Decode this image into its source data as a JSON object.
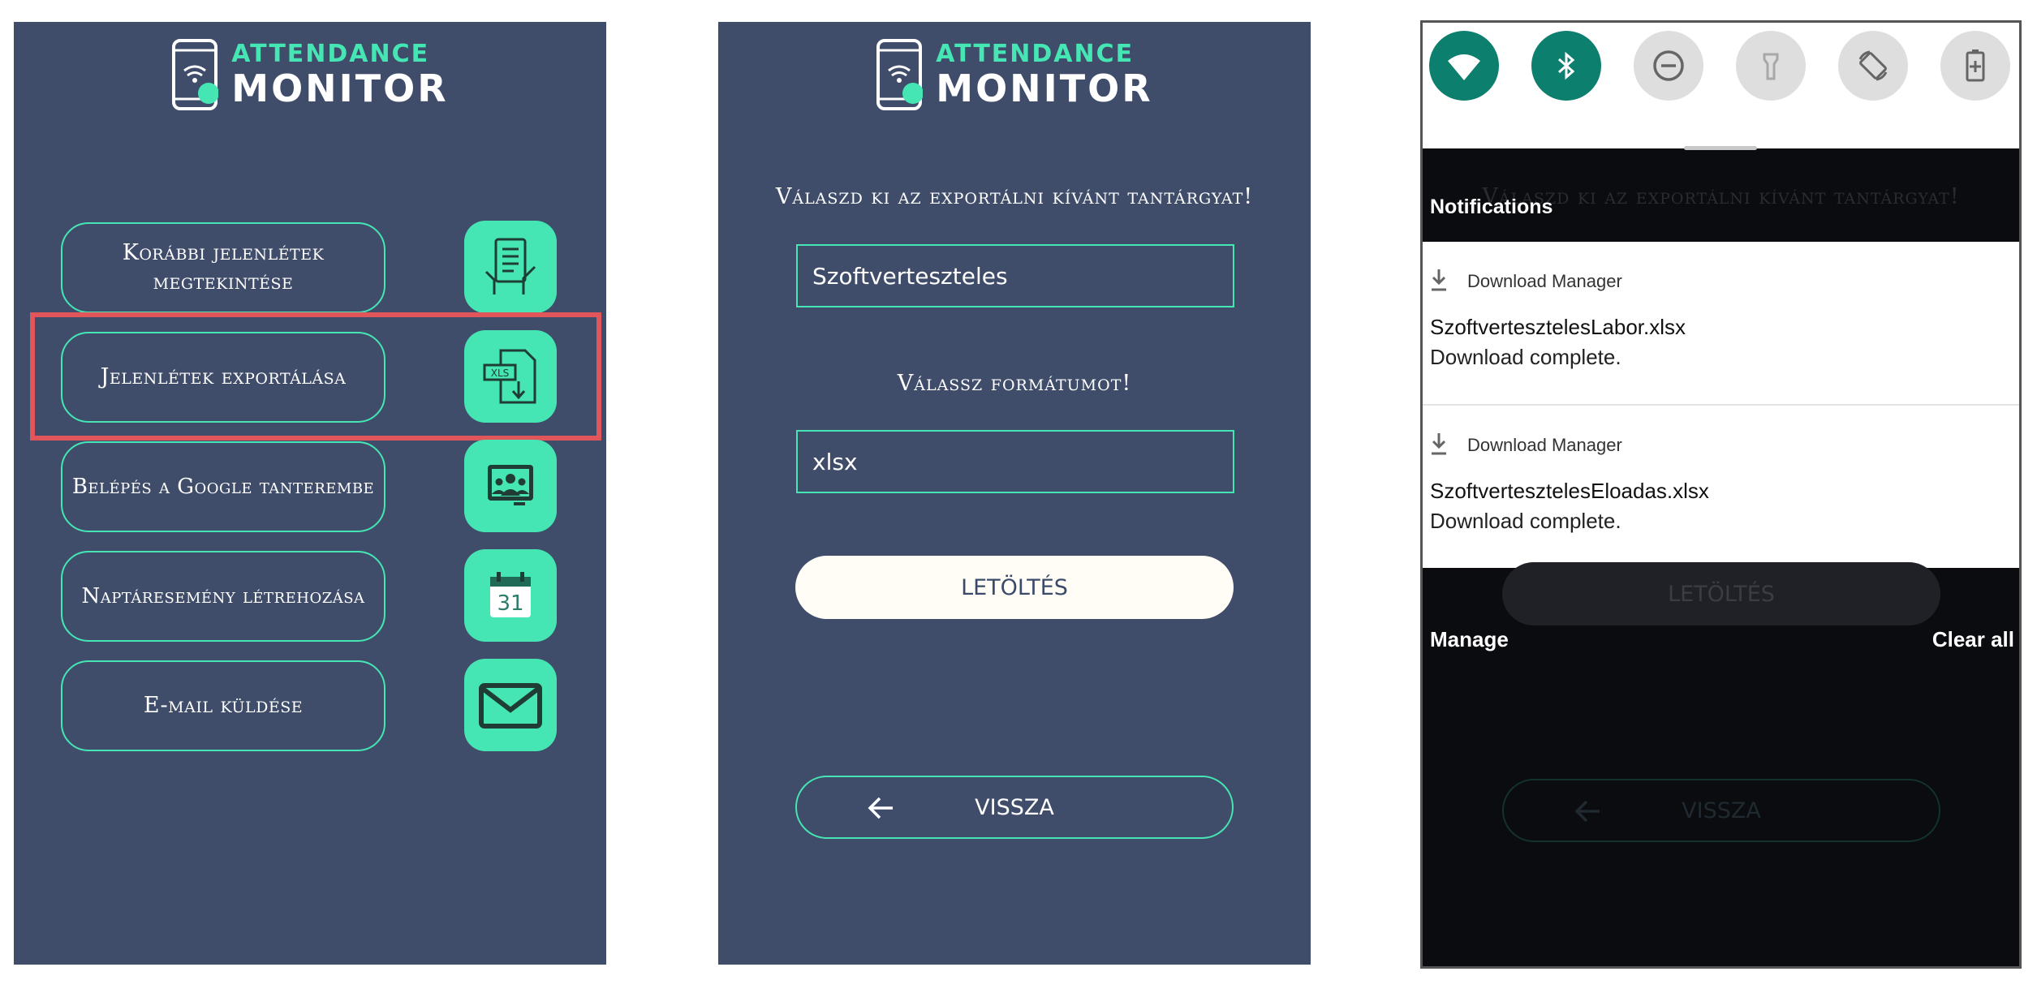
{
  "app": {
    "logo_line1": "ATTENDANCE",
    "logo_line2": "MONITOR"
  },
  "menu": {
    "items": [
      {
        "label": "Korábbi jelenlétek megtekintése",
        "icon": "tablet-checklist-icon"
      },
      {
        "label": "Jelenlétek exportálása",
        "icon": "xls-download-icon",
        "highlighted": true
      },
      {
        "label": "Belépés a Google tanterembe",
        "icon": "google-classroom-icon"
      },
      {
        "label": "Naptáresemény létrehozása",
        "icon": "calendar-icon",
        "icon_text": "31"
      },
      {
        "label": "E-mail küldése",
        "icon": "envelope-icon"
      }
    ]
  },
  "export": {
    "subject_prompt": "Válaszd ki az exportálni kívánt tantárgyat!",
    "subject_value": "Szoftverteszteles",
    "format_prompt": "Válassz formátumot!",
    "format_value": "xlsx",
    "download_label": "LETÖLTÉS",
    "back_label": "VISSZA"
  },
  "notifications": {
    "title": "Notifications",
    "quick_settings": [
      "wifi-icon",
      "bluetooth-icon",
      "do-not-disturb-icon",
      "flashlight-icon",
      "auto-rotate-icon",
      "battery-saver-icon"
    ],
    "items": [
      {
        "source": "Download Manager",
        "file": "SzoftvertesztelesLabor.xlsx",
        "status": "Download complete."
      },
      {
        "source": "Download Manager",
        "file": "SzoftvertesztelesEloadas.xlsx",
        "status": "Download complete."
      }
    ],
    "manage_label": "Manage",
    "clear_label": "Clear all"
  },
  "colors": {
    "background": "#3f4d6b",
    "accent": "#45e6b3",
    "highlight": "#e0565a",
    "qs_on": "#0c7f6f"
  }
}
